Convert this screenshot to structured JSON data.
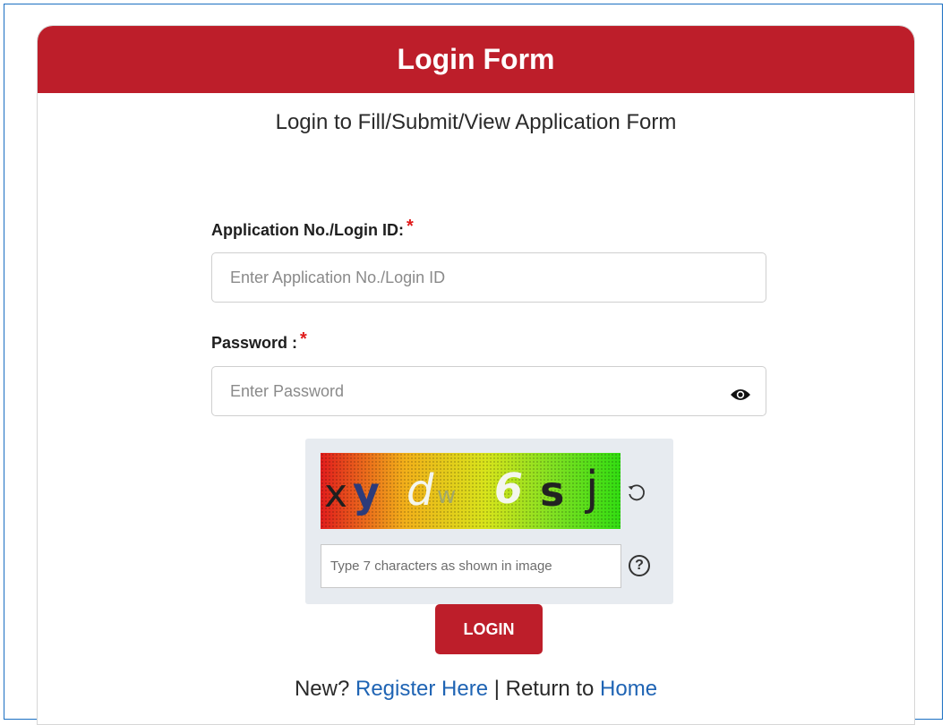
{
  "header": {
    "title": "Login Form"
  },
  "subtitle": "Login to Fill/Submit/View Application Form",
  "login_id": {
    "label": "Application No./Login ID:",
    "required_mark": "*",
    "placeholder": "Enter Application No./Login ID"
  },
  "password": {
    "label": "Password :",
    "required_mark": "*",
    "placeholder": "Enter Password",
    "toggle_icon": "eye-icon"
  },
  "captcha": {
    "characters": [
      "x",
      "y",
      "d",
      "w",
      "6",
      "s",
      "j"
    ],
    "placeholder": "Type 7 characters as shown in image",
    "refresh_icon": "refresh-icon",
    "help_icon": "help-icon",
    "help_glyph": "?"
  },
  "login_button": "LOGIN",
  "footer": {
    "new_text": "New?",
    "register_link": "Register Here",
    "separator": "|",
    "return_text": "Return to",
    "home_link": "Home"
  },
  "colors": {
    "brand_red": "#bd1e2a",
    "link_blue": "#1f64b4",
    "required_red": "#e01a1a"
  }
}
